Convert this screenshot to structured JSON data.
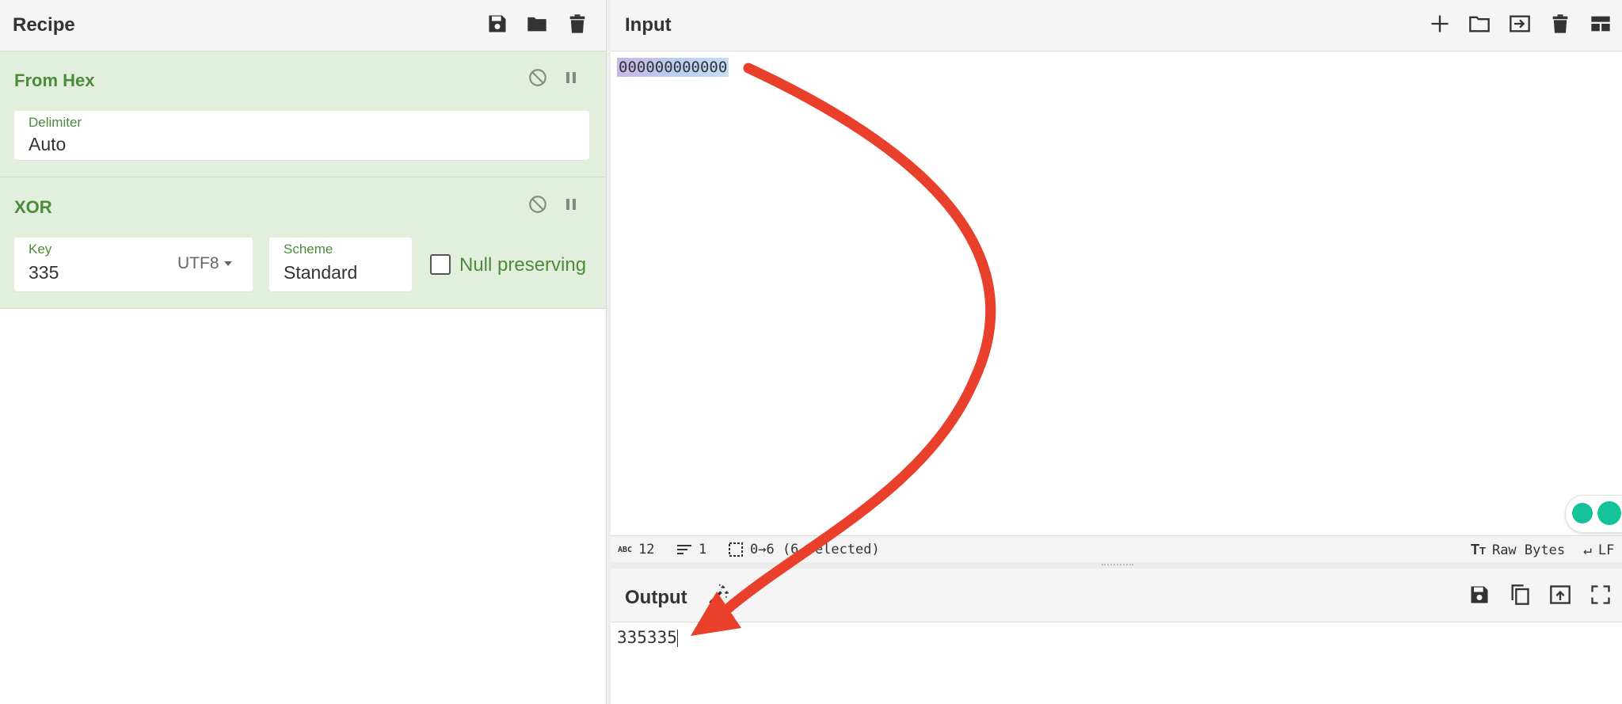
{
  "recipe": {
    "title": "Recipe",
    "icons": [
      "save-icon",
      "folder-icon",
      "trash-icon"
    ],
    "operations": [
      {
        "name": "From Hex",
        "icons": [
          "disable-icon",
          "pause-icon"
        ],
        "delimiter_label": "Delimiter",
        "delimiter_value": "Auto"
      },
      {
        "name": "XOR",
        "icons": [
          "disable-icon",
          "pause-icon"
        ],
        "key_label": "Key",
        "key_value": "335",
        "key_encoding": "UTF8",
        "scheme_label": "Scheme",
        "scheme_value": "Standard",
        "null_preserving_label": "Null preserving",
        "null_preserving_checked": false
      }
    ]
  },
  "input": {
    "title": "Input",
    "icons": [
      "plus-icon",
      "folder-icon",
      "input-arrow-icon",
      "trash-icon",
      "layout-icon"
    ],
    "text": "000000000000"
  },
  "status": {
    "chars_label": "ABC",
    "chars": "12",
    "lines": "1",
    "selection": "0→6 (6 selected)",
    "format": "Raw Bytes",
    "line_ending": "LF"
  },
  "output": {
    "title": "Output",
    "icons": [
      "magic-wand-icon",
      "save-icon",
      "copy-icon",
      "upload-icon",
      "fullscreen-icon"
    ],
    "text": "335335"
  },
  "colors": {
    "accent_green": "#4b8b3b",
    "op_background": "#e1efdc",
    "annotation_red": "#e8402a"
  }
}
